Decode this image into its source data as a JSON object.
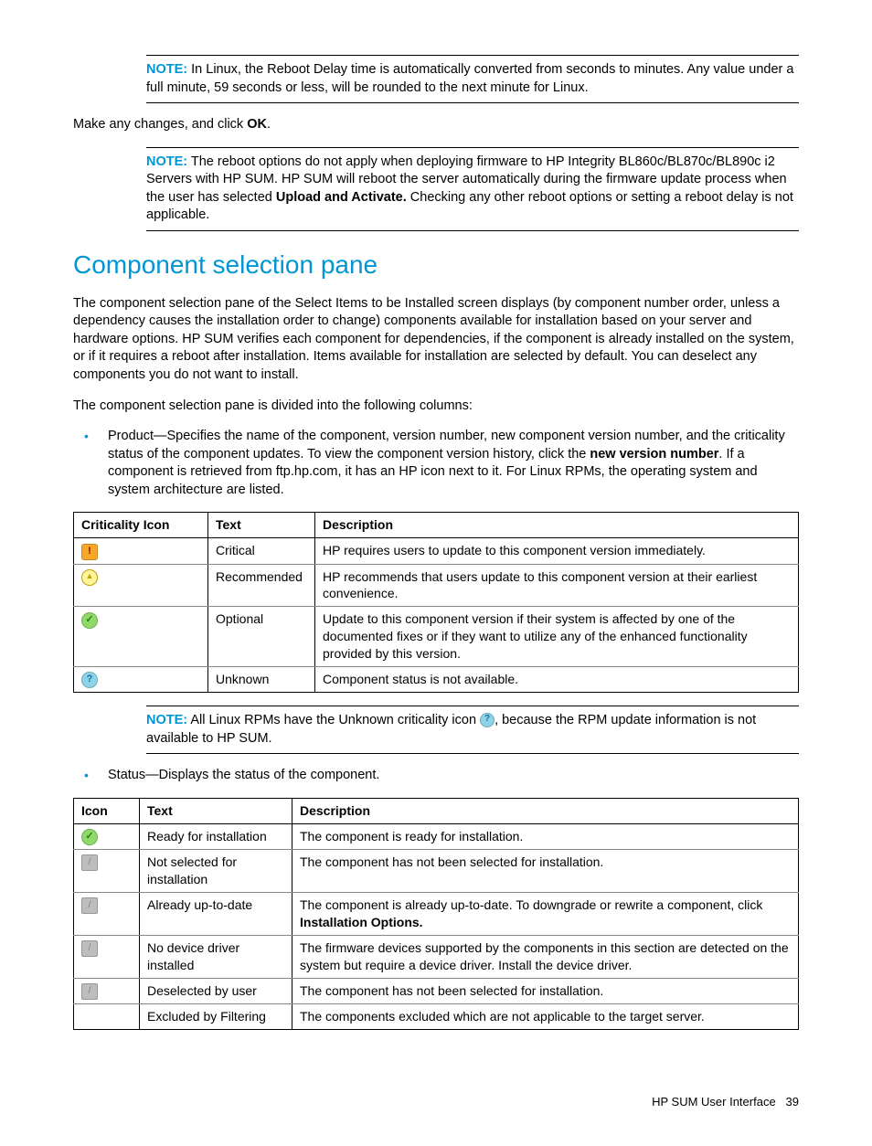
{
  "note1": {
    "label": "NOTE:",
    "text": "In Linux, the Reboot Delay time is automatically converted from seconds to minutes. Any value under a full minute, 59 seconds or less, will be rounded to the next minute for Linux."
  },
  "para1_pre": "Make any changes, and click ",
  "para1_bold": "OK",
  "para1_post": ".",
  "note2": {
    "label": "NOTE:",
    "text1": "The reboot options do not apply when deploying firmware to HP Integrity BL860c/BL870c/BL890c i2 Servers with HP SUM. HP SUM will reboot the server automatically during the firmware update process when the user has selected ",
    "bold": "Upload and Activate.",
    "text2": " Checking any other reboot options or setting a reboot delay is not applicable."
  },
  "heading": "Component selection pane",
  "para2": "The component selection pane of the Select Items to be Installed screen displays (by component number order, unless a dependency causes the installation order to change) components available for installation based on your server and hardware options. HP SUM verifies each component for dependencies, if the component is already installed on the system, or if it requires a reboot after installation. Items available for installation are selected by default. You can deselect any components you do not want to install.",
  "para3": "The component selection pane is divided into the following columns:",
  "bullet1_pre": "Product—Specifies the name of the component, version number, new component version number, and the criticality status of the component updates. To view the component version history, click the ",
  "bullet1_bold1": "new version number",
  "bullet1_post": ". If a component is retrieved from ftp.hp.com, it has an HP icon next to it. For Linux RPMs, the operating system and system architecture are listed.",
  "table1": {
    "headers": [
      "Criticality Icon",
      "Text",
      "Description"
    ],
    "rows": [
      {
        "icon": "critical",
        "text": "Critical",
        "desc": "HP requires users to update to this component version immediately."
      },
      {
        "icon": "recommended",
        "text": "Recommended",
        "desc": "HP recommends that users update to this component version at their earliest convenience."
      },
      {
        "icon": "optional",
        "text": "Optional",
        "desc": "Update to this component version if their system is affected by one of the documented fixes or if they want to utilize any of the enhanced functionality provided by this version."
      },
      {
        "icon": "unknown",
        "text": "Unknown",
        "desc": "Component status is not available."
      }
    ]
  },
  "note3": {
    "label": "NOTE:",
    "text1": "All Linux RPMs have the Unknown criticality icon ",
    "text2": ", because the RPM update information is not available to HP SUM."
  },
  "bullet2": "Status—Displays the status of the component.",
  "table2": {
    "headers": [
      "Icon",
      "Text",
      "Description"
    ],
    "rows": [
      {
        "icon": "ready",
        "text": "Ready for installation",
        "desc": "The component is ready for installation."
      },
      {
        "icon": "grey",
        "text": "Not selected for installation",
        "desc": "The component has not been selected for installation."
      },
      {
        "icon": "grey",
        "text": "Already up-to-date",
        "desc_pre": "The component is already up-to-date. To downgrade or rewrite a component, click ",
        "desc_bold": "Installation Options.",
        "desc_post": ""
      },
      {
        "icon": "grey",
        "text": "No device driver installed",
        "desc": "The firmware devices supported by the components in this section are detected on the system but require a device driver. Install the device driver."
      },
      {
        "icon": "grey",
        "text": "Deselected by user",
        "desc": "The component has not been selected for installation."
      },
      {
        "icon": "",
        "text": "Excluded by Filtering",
        "desc": "The components excluded which are not applicable to the target server."
      }
    ]
  },
  "footer": {
    "text": "HP SUM User Interface",
    "page": "39"
  }
}
